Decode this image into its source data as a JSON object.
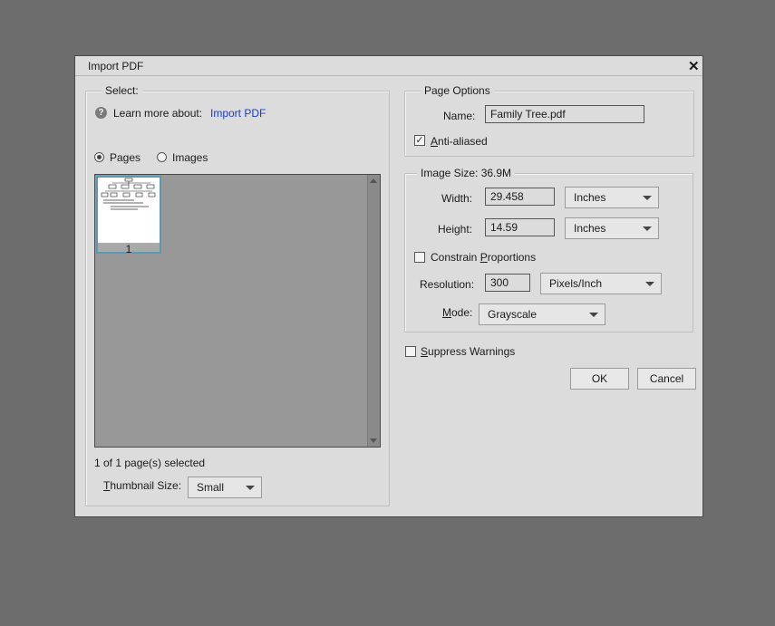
{
  "dialog": {
    "title": "Import PDF"
  },
  "select_group": {
    "legend": "Select:",
    "learn_more_prefix": "Learn more about:",
    "learn_more_link": "Import PDF",
    "radio_pages": "Pages",
    "radio_images": "Images",
    "selected_radio": "Pages",
    "thumbnail_page_number": "1",
    "status": "1 of 1 page(s) selected",
    "thumb_size_label": "Thumbnail Size:",
    "thumb_size_value": "Small"
  },
  "page_options": {
    "legend": "Page Options",
    "name_label": "Name:",
    "name_value": "Family Tree.pdf",
    "anti_aliased_label": "Anti-aliased",
    "anti_aliased_checked": true
  },
  "image_size": {
    "legend": "Image Size: 36.9M",
    "width_label": "Width:",
    "width_value": "29.458",
    "width_unit": "Inches",
    "height_label": "Height:",
    "height_value": "14.59",
    "height_unit": "Inches",
    "constrain_label": "Constrain Proportions",
    "constrain_checked": false,
    "resolution_label": "Resolution:",
    "resolution_value": "300",
    "resolution_unit": "Pixels/Inch",
    "mode_label": "Mode:",
    "mode_value": "Grayscale"
  },
  "suppress_warnings": {
    "label": "Suppress Warnings",
    "checked": false
  },
  "buttons": {
    "ok": "OK",
    "cancel": "Cancel"
  }
}
